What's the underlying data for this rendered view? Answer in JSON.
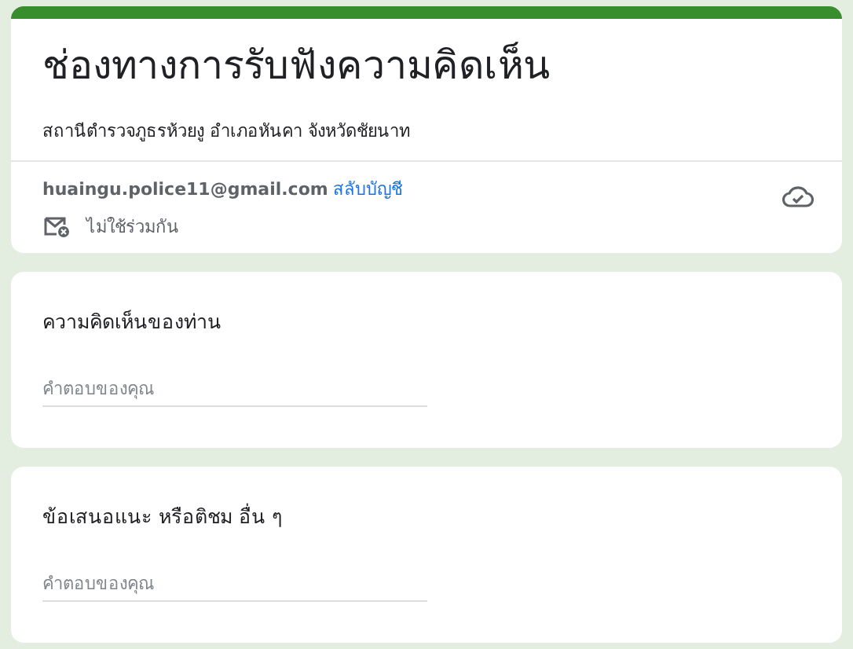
{
  "form": {
    "title": "ช่องทางการรับฟังความคิดเห็น",
    "description": "สถานีตำรวจภูธรห้วยงู อำเภอหันคา จังหวัดชัยนาท"
  },
  "account": {
    "email": "huaingu.police11@gmail.com",
    "switch_link": "สลับบัญชี",
    "sharing_note": "ไม่ใช้ร่วมกัน"
  },
  "questions": [
    {
      "label": "ความคิดเห็นของท่าน",
      "placeholder": "คำตอบของคุณ"
    },
    {
      "label": "ข้อเสนอแนะ หรือติชม อื่น ๆ",
      "placeholder": "คำตอบของคุณ"
    }
  ]
}
